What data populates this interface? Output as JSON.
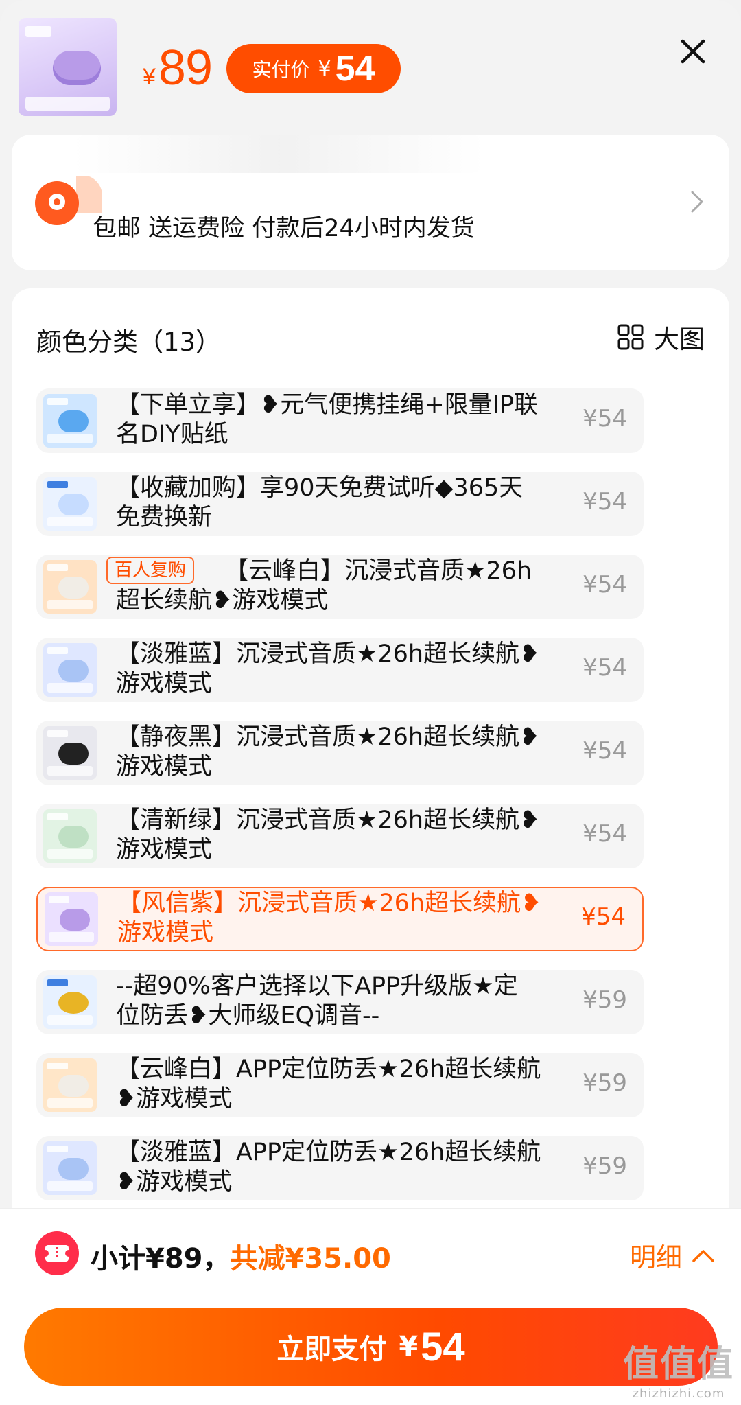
{
  "header": {
    "original_price_currency": "¥",
    "original_price": "89",
    "paid_label": "实付价",
    "paid_currency": "¥",
    "paid_price": "54",
    "close_icon": "close-icon"
  },
  "shipping": {
    "text": "包邮 送运费险 付款后24小时内发货",
    "icon": "location-pin-icon"
  },
  "options": {
    "title": "颜色分类（13）",
    "big_picture_label": "大图",
    "items": [
      {
        "text": "【下单立享】❥元气便携挂绳+限量IP联名DIY贴纸",
        "price": "¥54",
        "thumb": "#cfe6ff",
        "case": "#5aa8f0"
      },
      {
        "text": "【收藏加购】享90天免费试听◆365天免费换新",
        "price": "¥54",
        "thumb": "#eaf2ff",
        "case": "#3f7fe0"
      },
      {
        "badge": "百人复购",
        "text": "【云峰白】沉浸式音质★26h超长续航❥游戏模式",
        "price": "¥54",
        "thumb": "#ffe2c4",
        "case": "#f1ede6"
      },
      {
        "text": "【淡雅蓝】沉浸式音质★26h超长续航❥游戏模式",
        "price": "¥54",
        "thumb": "#dfe7ff",
        "case": "#a9c4f5"
      },
      {
        "text": "【静夜黑】沉浸式音质★26h超长续航❥游戏模式",
        "price": "¥54",
        "thumb": "#e8e8ee",
        "case": "#222"
      },
      {
        "text": "【清新绿】沉浸式音质★26h超长续航❥游戏模式",
        "price": "¥54",
        "thumb": "#e2f3e4",
        "case": "#cfe9d2"
      },
      {
        "text": "【风信紫】沉浸式音质★26h超长续航❥游戏模式",
        "price": "¥54",
        "thumb": "#ebe0ff",
        "case": "#b89be8",
        "selected": true
      },
      {
        "text": "--超90%客户选择以下APP升级版★定位防丢❥大师级EQ调音--",
        "price": "¥59",
        "thumb": "#e7f1ff",
        "case": "#e8b425"
      },
      {
        "text": "【云峰白】APP定位防丢★26h超长续航❥游戏模式",
        "price": "¥59",
        "thumb": "#ffe6c8",
        "case": "#f1ede6"
      },
      {
        "text": "【淡雅蓝】APP定位防丢★26h超长续航❥游戏模式",
        "price": "¥59",
        "thumb": "#dfe7ff",
        "case": "#a9c4f5"
      }
    ]
  },
  "bottom": {
    "subtotal": "小计¥89，",
    "discount": "共减¥35.00",
    "detail_label": "明细",
    "pay_label": "立即支付",
    "pay_currency": "¥",
    "pay_amount": "54"
  },
  "watermark": {
    "main": "值值值",
    "domain": "zhizhizhi.com"
  },
  "colors": {
    "accent": "#ff4d00",
    "selected_bg": "#fff3ee"
  }
}
